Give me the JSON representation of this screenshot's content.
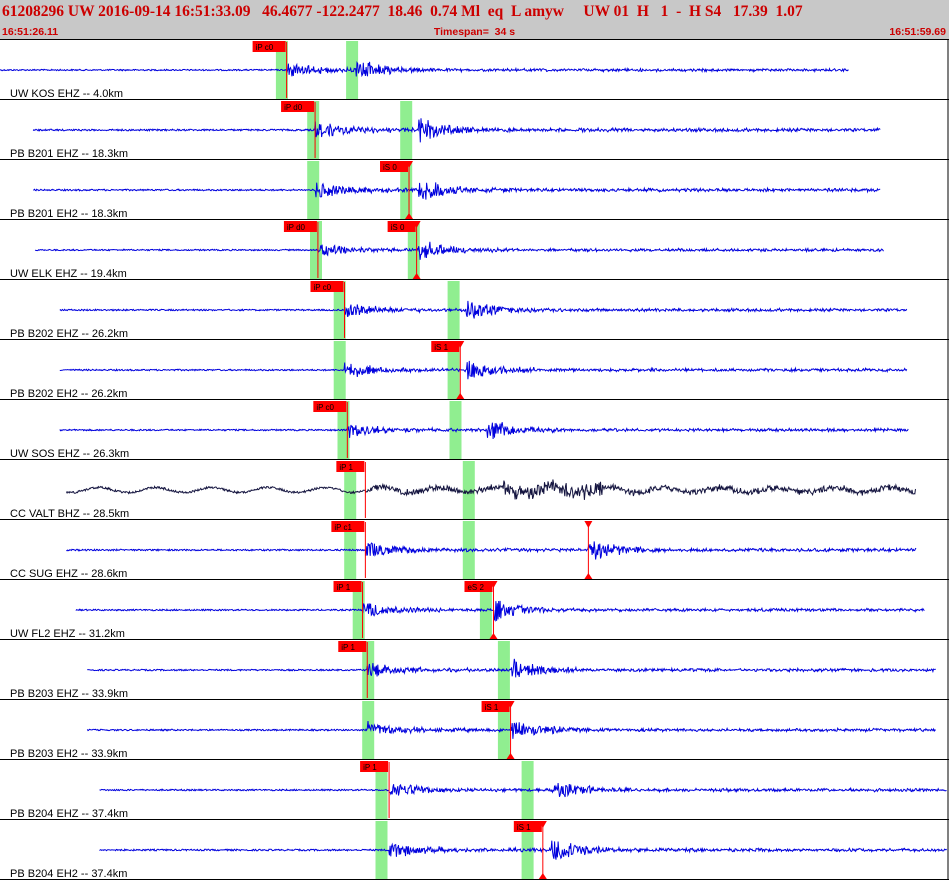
{
  "header": {
    "title": "61208296 UW 2016-09-14 16:51:33.09   46.4677 -122.2477  18.46  0.74 Ml  eq  L amyw     UW 01  H   1  -  H S4   17.39  1.07",
    "start_time": "16:51:26.11",
    "timespan": "Timespan=  34 s",
    "end_time": "16:51:59.69"
  },
  "colors": {
    "trace": "#0000dd",
    "trace_dark": "#151540",
    "pick": "#ff0000",
    "window": "#90ee90",
    "header_bg": "#c8c8c8",
    "header_text": "#cc0000"
  },
  "traces": [
    {
      "label": "UW KOS EHZ -- 4.0km",
      "start": 0.0,
      "end": 0.894,
      "onset": 0.302,
      "s_onset": 0.375,
      "amp": 0.7,
      "color": "blue",
      "picks": [
        {
          "text": "iP c0",
          "x": 0.302
        }
      ],
      "windows": [
        {
          "x": 0.297
        },
        {
          "x": 0.371
        }
      ]
    },
    {
      "label": "PB B201 EHZ -- 18.3km",
      "start": 0.035,
      "end": 0.928,
      "onset": 0.332,
      "s_onset": 0.441,
      "amp": 0.85,
      "color": "blue",
      "picks": [
        {
          "text": "iP d0",
          "x": 0.332
        }
      ],
      "windows": [
        {
          "x": 0.33
        },
        {
          "x": 0.428
        }
      ]
    },
    {
      "label": "PB B201 EH2 -- 18.3km",
      "start": 0.035,
      "end": 0.928,
      "onset": 0.332,
      "s_onset": 0.441,
      "amp": 0.8,
      "color": "blue",
      "picks": [
        {
          "text": "iS 0",
          "x": 0.431,
          "marker": true
        }
      ],
      "windows": [
        {
          "x": 0.33
        },
        {
          "x": 0.428
        }
      ]
    },
    {
      "label": "UW ELK EHZ -- 19.4km",
      "start": 0.037,
      "end": 0.931,
      "onset": 0.335,
      "s_onset": 0.441,
      "amp": 0.7,
      "color": "blue",
      "picks": [
        {
          "text": "iP d0",
          "x": 0.335
        },
        {
          "text": "iS 0",
          "x": 0.439,
          "marker": true
        }
      ],
      "windows": [
        {
          "x": 0.333
        },
        {
          "x": 0.436
        }
      ]
    },
    {
      "label": "PB B202 EHZ -- 26.2km",
      "start": 0.063,
      "end": 0.956,
      "onset": 0.363,
      "s_onset": 0.491,
      "amp": 0.75,
      "color": "blue",
      "picks": [
        {
          "text": "iP c0",
          "x": 0.363
        }
      ],
      "windows": [
        {
          "x": 0.358
        },
        {
          "x": 0.478
        }
      ]
    },
    {
      "label": "PB B202 EH2 -- 26.2km",
      "start": 0.063,
      "end": 0.956,
      "onset": 0.363,
      "s_onset": 0.491,
      "amp": 0.75,
      "color": "blue",
      "picks": [
        {
          "text": "iS 1",
          "x": 0.485,
          "marker": true
        }
      ],
      "windows": [
        {
          "x": 0.358
        },
        {
          "x": 0.478
        }
      ]
    },
    {
      "label": "UW SOS EHZ -- 26.3km",
      "start": 0.063,
      "end": 0.957,
      "onset": 0.366,
      "s_onset": 0.513,
      "amp": 0.75,
      "color": "blue",
      "picks": [
        {
          "text": "iP c0",
          "x": 0.366
        }
      ],
      "windows": [
        {
          "x": 0.362
        },
        {
          "x": 0.48
        }
      ]
    },
    {
      "label": "CC VALT BHZ -- 28.5km",
      "start": 0.07,
      "end": 0.965,
      "onset": 0.385,
      "s_onset": 0.573,
      "amp": 0.75,
      "color": "dark",
      "picks": [
        {
          "text": "iP 1",
          "x": 0.385
        }
      ],
      "windows": [
        {
          "x": 0.369
        },
        {
          "x": 0.494
        }
      ]
    },
    {
      "label": "CC SUG EHZ -- 28.6km",
      "start": 0.07,
      "end": 0.966,
      "onset": 0.385,
      "s_onset": 0.62,
      "amp": 0.8,
      "color": "blue",
      "picks": [
        {
          "text": "iP c1",
          "x": 0.385
        },
        {
          "text": "",
          "x": 0.62,
          "marker": true
        }
      ],
      "windows": [
        {
          "x": 0.369
        },
        {
          "x": 0.494
        }
      ]
    },
    {
      "label": "UW FL2 EHZ -- 31.2km",
      "start": 0.08,
      "end": 0.974,
      "onset": 0.382,
      "s_onset": 0.52,
      "amp": 0.75,
      "color": "blue",
      "picks": [
        {
          "text": "iP 1",
          "x": 0.382
        },
        {
          "text": "eS 2",
          "x": 0.52,
          "marker": true
        }
      ],
      "windows": [
        {
          "x": 0.378
        },
        {
          "x": 0.512
        }
      ]
    },
    {
      "label": "PB B203 EHZ -- 33.9km",
      "start": 0.092,
      "end": 0.986,
      "onset": 0.387,
      "s_onset": 0.538,
      "amp": 0.75,
      "color": "blue",
      "picks": [
        {
          "text": "iP 1",
          "x": 0.387
        }
      ],
      "windows": [
        {
          "x": 0.388
        },
        {
          "x": 0.531
        }
      ]
    },
    {
      "label": "PB B203 EH2 -- 33.9km",
      "start": 0.092,
      "end": 0.986,
      "onset": 0.387,
      "s_onset": 0.538,
      "amp": 0.75,
      "color": "blue",
      "picks": [
        {
          "text": "iS 1",
          "x": 0.538,
          "marker": true
        }
      ],
      "windows": [
        {
          "x": 0.388
        },
        {
          "x": 0.531
        }
      ]
    },
    {
      "label": "PB B204 EHZ -- 37.4km",
      "start": 0.105,
      "end": 0.998,
      "onset": 0.41,
      "s_onset": 0.581,
      "amp": 0.75,
      "color": "blue",
      "picks": [
        {
          "text": "iP 1",
          "x": 0.41
        }
      ],
      "windows": [
        {
          "x": 0.402
        },
        {
          "x": 0.556
        }
      ]
    },
    {
      "label": "PB B204 EH2 -- 37.4km",
      "start": 0.105,
      "end": 0.998,
      "onset": 0.41,
      "s_onset": 0.581,
      "amp": 0.8,
      "color": "blue",
      "picks": [
        {
          "text": "iS 1",
          "x": 0.572,
          "marker": true
        }
      ],
      "windows": [
        {
          "x": 0.402
        },
        {
          "x": 0.556
        }
      ]
    }
  ]
}
